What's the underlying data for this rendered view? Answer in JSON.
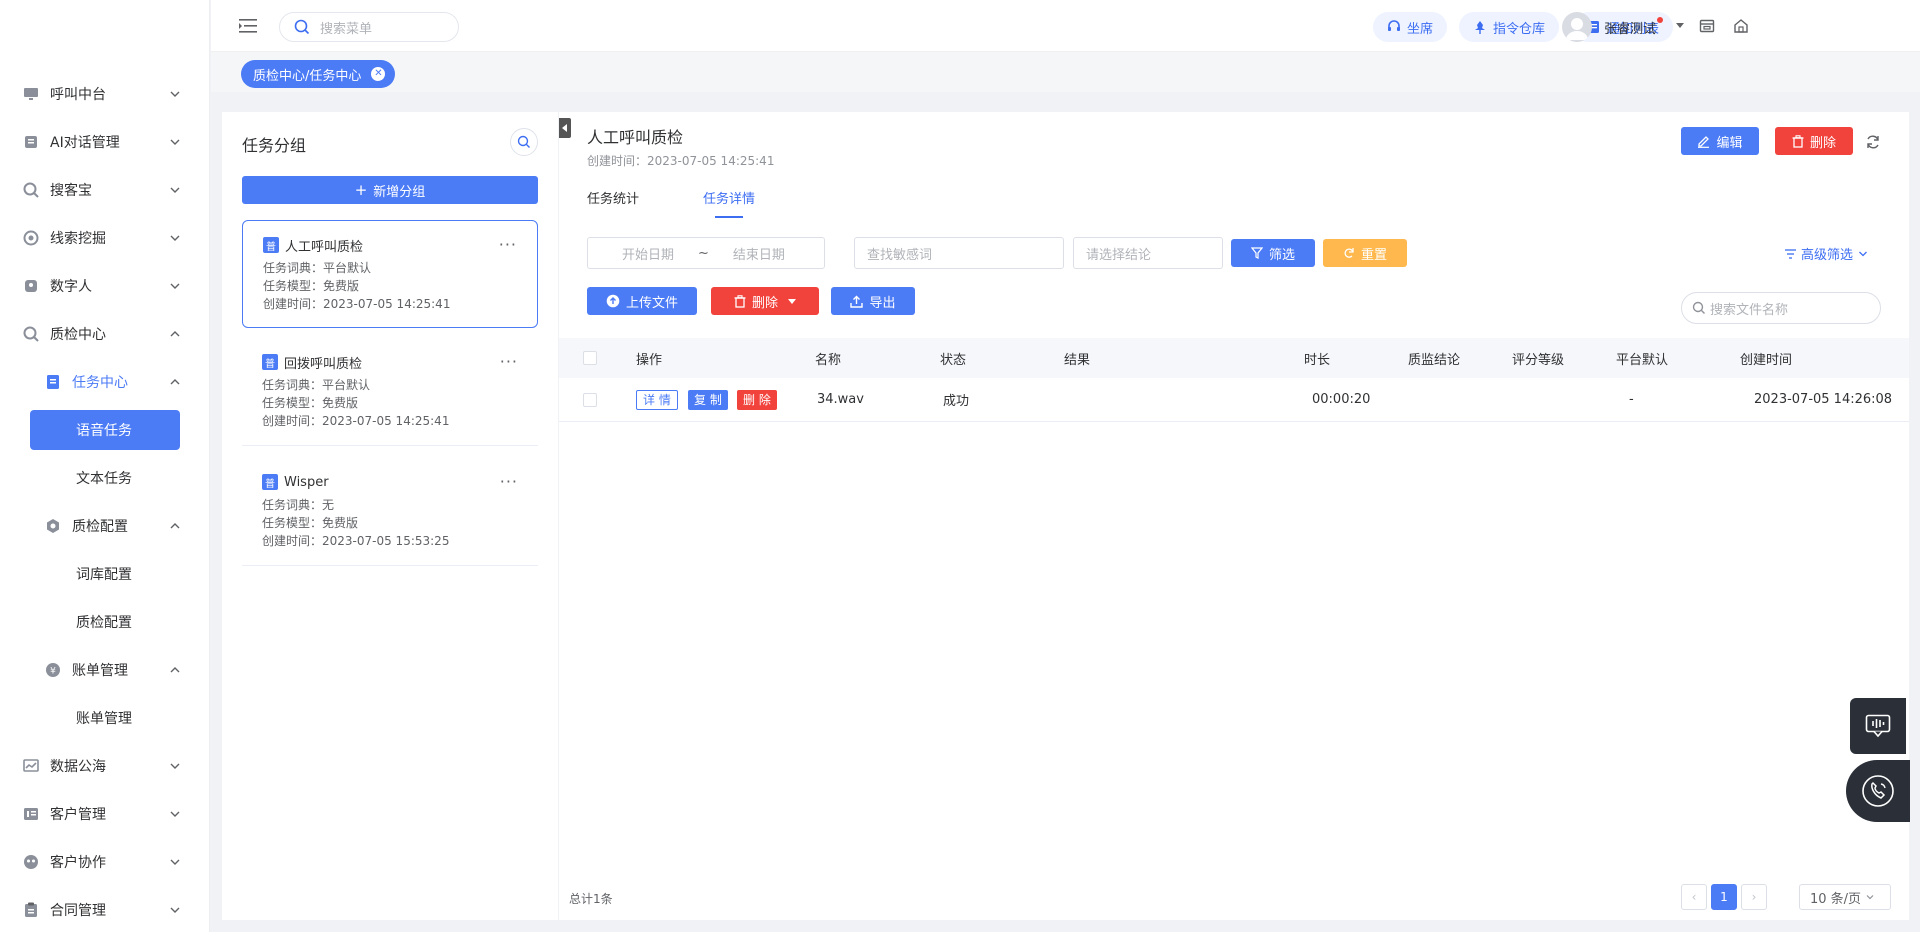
{
  "sidebar": {
    "items": [
      {
        "label": "呼叫中台",
        "icon": "monitor-icon"
      },
      {
        "label": "AI对话管理",
        "icon": "robot-icon"
      },
      {
        "label": "搜客宝",
        "icon": "search-globe-icon"
      },
      {
        "label": "线索挖掘",
        "icon": "target-icon"
      },
      {
        "label": "数字人",
        "icon": "person-icon"
      },
      {
        "label": "质检中心",
        "icon": "qc-icon"
      }
    ],
    "qc_children": {
      "task_center": "任务中心",
      "voice_task": "语音任务",
      "text_task": "文本任务",
      "qc_config": "质检配置",
      "lexicon_config": "词库配置",
      "qc_config_leaf": "质检配置",
      "bill_manage": "账单管理",
      "bill_manage_leaf": "账单管理"
    },
    "bottom_items": [
      {
        "label": "数据公海",
        "icon": "chart-icon"
      },
      {
        "label": "客户管理",
        "icon": "customer-icon"
      },
      {
        "label": "客户协作",
        "icon": "collab-icon"
      },
      {
        "label": "合同管理",
        "icon": "contract-icon"
      }
    ]
  },
  "header": {
    "search_placeholder": "搜索菜单",
    "pills": [
      "坐席",
      "指令仓库",
      "通知列表"
    ],
    "username": "张睿测试"
  },
  "tagbar": {
    "tag": "质检中心/任务中心"
  },
  "group_panel": {
    "title": "任务分组",
    "add_button": "新增分组",
    "groups": [
      {
        "badge": "普",
        "name": "人工呼叫质检",
        "dict": "任务词典：平台默认",
        "model": "任务模型：免费版",
        "created": "创建时间：2023-07-05 14:25:41"
      },
      {
        "badge": "普",
        "name": "回拨呼叫质检",
        "dict": "任务词典：平台默认",
        "model": "任务模型：免费版",
        "created": "创建时间：2023-07-05 14:25:41"
      },
      {
        "badge": "普",
        "name": "Wisper",
        "dict": "任务词典：无",
        "model": "任务模型：免费版",
        "created": "创建时间：2023-07-05 15:53:25"
      }
    ]
  },
  "main": {
    "title": "人工呼叫质检",
    "subtitle": "创建时间：2023-07-05 14:25:41",
    "edit_button": "编辑",
    "delete_button": "删除",
    "tabs": [
      "任务统计",
      "任务详情"
    ],
    "filters": {
      "start_date": "开始日期",
      "tilde": "~",
      "end_date": "结束日期",
      "keyword_placeholder": "查找敏感词",
      "conclusion_placeholder": "请选择结论",
      "filter_button": "筛选",
      "reset_button": "重置",
      "advanced": "高级筛选"
    },
    "actions": {
      "upload": "上传文件",
      "delete": "删除",
      "export": "导出",
      "file_search_placeholder": "搜索文件名称"
    },
    "table": {
      "headers": [
        "操作",
        "名称",
        "状态",
        "结果",
        "时长",
        "质监结论",
        "评分等级",
        "平台默认",
        "创建时间"
      ],
      "rows": [
        {
          "detail": "详 情",
          "copy": "复 制",
          "del": "删 除",
          "name": "34.wav",
          "status": "成功",
          "result": "",
          "duration": "00:00:20",
          "conclusion": "",
          "grade": "",
          "platform": "-",
          "created": "2023-07-05 14:26:08"
        }
      ]
    },
    "footer": {
      "total": "总计1条",
      "current_page": "1",
      "page_size": "10 条/页"
    }
  },
  "colors": {
    "accent": "#4b7bf5",
    "danger": "#f2423c",
    "warning": "#ffb84d"
  }
}
